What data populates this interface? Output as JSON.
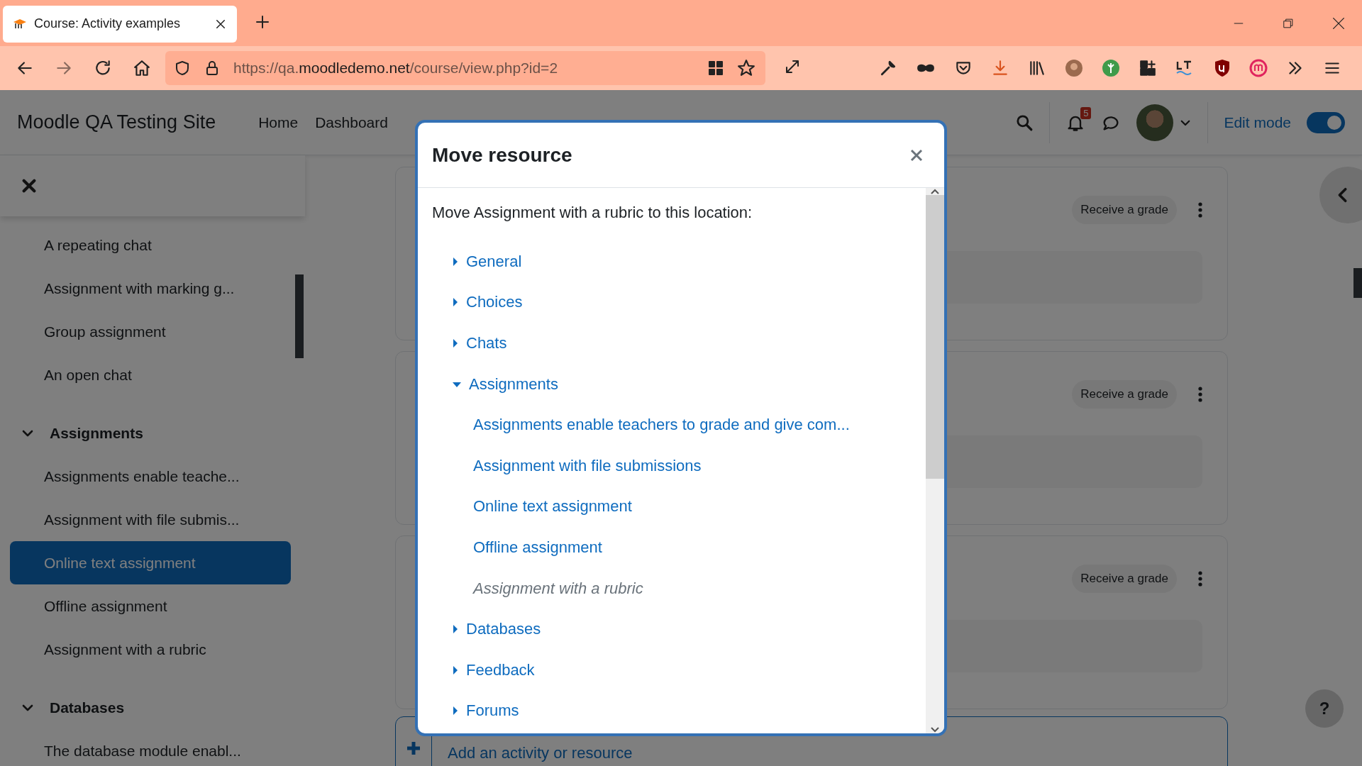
{
  "browser": {
    "tab": {
      "title": "Course: Activity examples",
      "selected": true
    },
    "url": "https://qa.**moodledemo.net**/course/view.php?id=2"
  },
  "header": {
    "site_name": "Moodle QA Testing Site",
    "nav": [
      {
        "label": "Home",
        "selected": false
      },
      {
        "label": "Dashboard",
        "selected": false
      }
    ],
    "notification_count": "5",
    "edit_mode": {
      "label": "Edit mode",
      "on": true
    }
  },
  "sidebar": {
    "groups": [
      {
        "items": [
          {
            "label": "A repeating chat",
            "selected": false
          },
          {
            "label": "Assignment with marking g...",
            "selected": false
          },
          {
            "label": "Group assignment",
            "selected": false
          },
          {
            "label": "An open chat",
            "selected": false
          }
        ]
      },
      {
        "title": "Assignments",
        "expanded": true,
        "items": [
          {
            "label": "Assignments enable teache...",
            "selected": false
          },
          {
            "label": "Assignment with file submis...",
            "selected": false
          },
          {
            "label": "Online text assignment",
            "selected": true
          },
          {
            "label": "Offline assignment",
            "selected": false
          },
          {
            "label": "Assignment with a rubric",
            "selected": false
          }
        ]
      },
      {
        "title": "Databases",
        "expanded": true,
        "items": [
          {
            "label": "The database module enabl...",
            "selected": false
          }
        ]
      }
    ]
  },
  "activities": [
    {
      "badge": "Receive a grade"
    },
    {
      "badge": "Receive a grade"
    },
    {
      "badge": "Receive a grade"
    }
  ],
  "add_activity": "Add an activity or resource",
  "help": "?",
  "modal": {
    "title": "Move resource",
    "prompt": "Move Assignment with a rubric to this location:",
    "tree": [
      {
        "label": "General",
        "expanded": false
      },
      {
        "label": "Choices",
        "expanded": false
      },
      {
        "label": "Chats",
        "expanded": false
      },
      {
        "label": "Assignments",
        "expanded": true,
        "children": [
          {
            "label": "Assignments enable teachers to grade and give com...",
            "disabled": false
          },
          {
            "label": "Assignment with file submissions",
            "disabled": false
          },
          {
            "label": "Online text assignment",
            "disabled": false
          },
          {
            "label": "Offline assignment",
            "disabled": false
          },
          {
            "label": "Assignment with a rubric",
            "disabled": true
          }
        ]
      },
      {
        "label": "Databases",
        "expanded": false
      },
      {
        "label": "Feedback",
        "expanded": false
      },
      {
        "label": "Forums",
        "expanded": false
      }
    ]
  }
}
